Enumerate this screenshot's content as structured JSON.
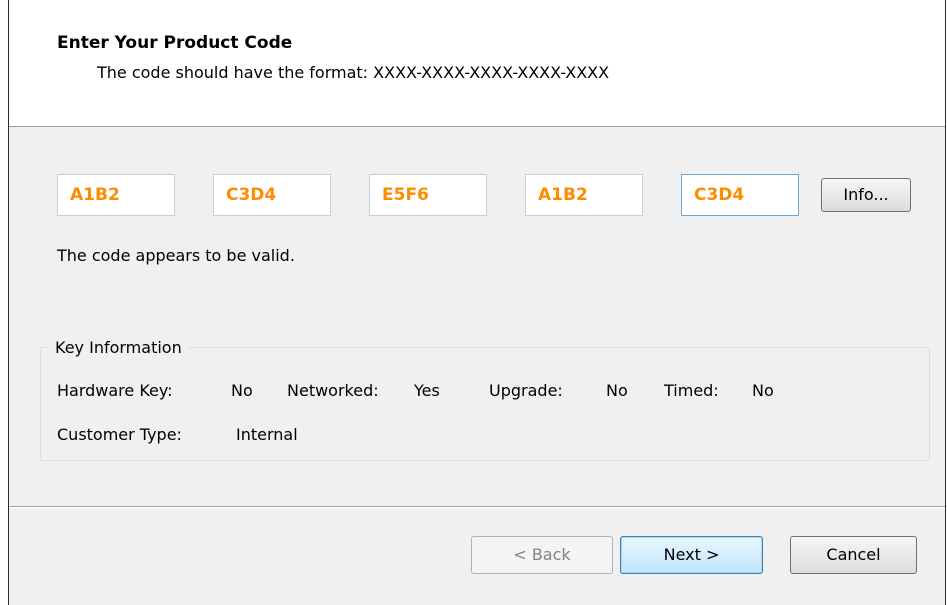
{
  "header": {
    "title": "Enter Your Product Code",
    "subtitle": "The code should have the format: XXXX-XXXX-XXXX-XXXX-XXXX"
  },
  "code_fields": [
    "A1B2",
    "C3D4",
    "E5F6",
    "A1B2",
    "C3D4"
  ],
  "info_button": "Info...",
  "status_message": "The code appears to be valid.",
  "key_info": {
    "legend": "Key Information",
    "hardware_key_label": "Hardware Key:",
    "hardware_key_value": "No",
    "networked_label": "Networked:",
    "networked_value": "Yes",
    "upgrade_label": "Upgrade:",
    "upgrade_value": "No",
    "timed_label": "Timed:",
    "timed_value": "No",
    "customer_type_label": "Customer Type:",
    "customer_type_value": "Internal"
  },
  "buttons": {
    "back": "< Back",
    "next": "Next >",
    "cancel": "Cancel"
  },
  "colors": {
    "code_text": "#ff8c00",
    "dialog_bg": "#f0f0f0",
    "header_bg": "#ffffff"
  }
}
